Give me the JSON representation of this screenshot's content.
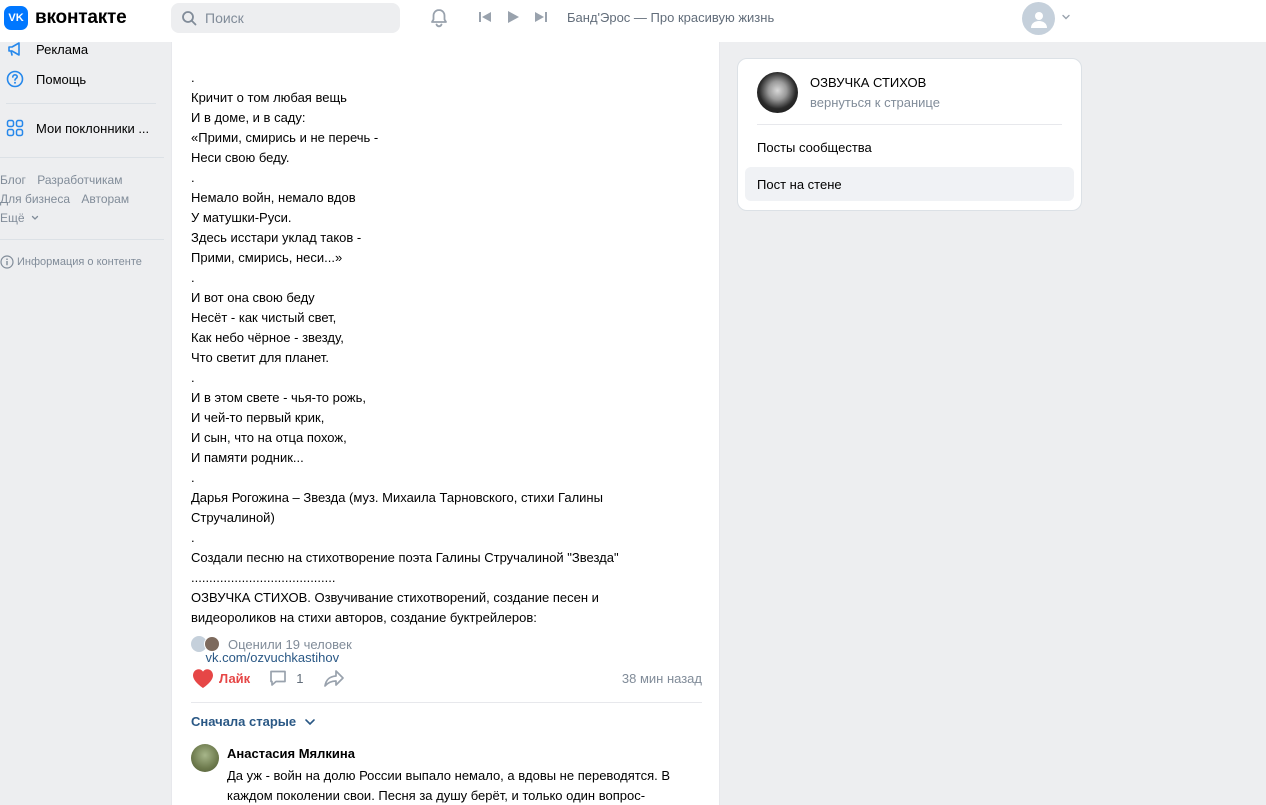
{
  "header": {
    "logo_mark": "VK",
    "logo_text": "вконтакте",
    "search_placeholder": "Поиск",
    "now_playing": "Банд'Эрос — Про красивую жизнь"
  },
  "sidebar": {
    "items": [
      {
        "label": "Реклама",
        "icon": "megaphone-icon"
      },
      {
        "label": "Помощь",
        "icon": "help-icon"
      },
      {
        "label": "Мои поклонники ...",
        "icon": "apps-icon"
      }
    ],
    "footer_row1": [
      "Блог",
      "Разработчикам"
    ],
    "footer_row2": [
      "Для бизнеса",
      "Авторам"
    ],
    "more": "Ещё",
    "content_info": "Информация о контенте"
  },
  "post": {
    "lines": [
      ".",
      "Кричит о том любая вещь",
      "И в доме, и в саду:",
      "«Прими, смирись и не перечь -",
      "Неси свою беду.",
      ".",
      "Немало войн, немало вдов",
      "У матушки-Руси.",
      "Здесь исстари уклад таков -",
      "Прими, смирись, неси...»",
      ".",
      "И вот она свою беду",
      "Несёт - как чистый свет,",
      "Как небо чёрное - звезду,",
      "Что светит для планет.",
      ".",
      "И в этом свете - чья-то рожь,",
      "И чей-то первый крик,",
      "И сын, что на отца похож,",
      "И памяти родник...",
      ".",
      "Дарья Рогожина – Звезда (муз. Михаила Тарновского, стихи Галины",
      "Стручалиной)",
      ".",
      "Создали песню на стихотворение поэта Галины Стручалиной \"Звезда\"",
      "........................................",
      "ОЗВУЧКА СТИХОВ. Озвучивание стихотворений, создание песен и",
      "видеороликов на стихи авторов, создание буктрейлеров:"
    ],
    "link": "vk.com/ozvuchkastihov",
    "likes_summary": "Оценили 19 человек",
    "like_label": "Лайк",
    "comments_count": "1",
    "time": "38 мин назад",
    "sort_label": "Сначала старые",
    "like_color": "#e64646",
    "link_color": "#2a5885"
  },
  "comment": {
    "author": "Анастасия Мялкина",
    "text": "Да уж - войн на долю России выпало немало, а вдовы не переводятся. В каждом поколении свои. Песня за душу берёт, и только один вопрос-"
  },
  "right": {
    "title": "ОЗВУЧКА СТИХОВ",
    "subtitle": "вернуться к странице",
    "items": [
      "Посты сообщества",
      "Пост на стене"
    ],
    "active_item": "Пост на стене"
  }
}
